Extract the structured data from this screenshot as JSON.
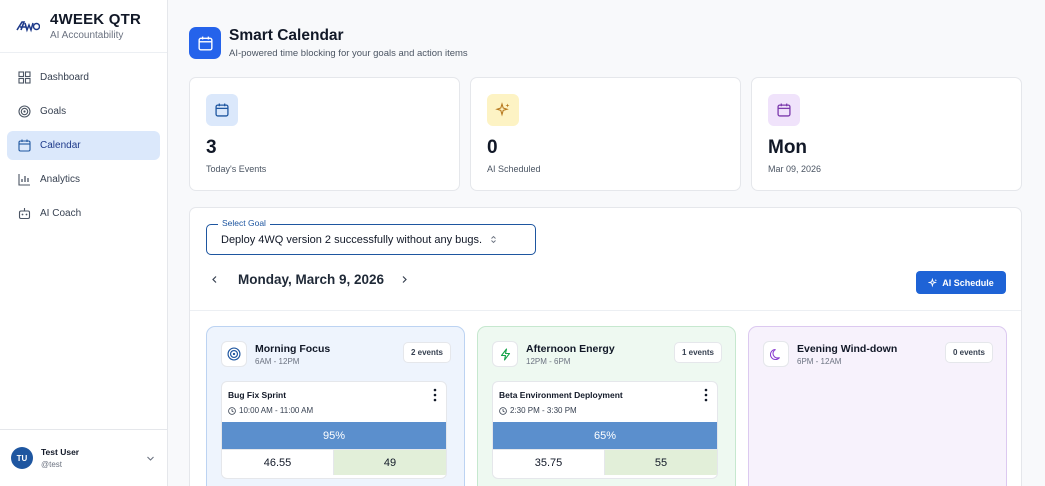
{
  "brand": {
    "title": "4WEEK QTR",
    "subtitle": "AI Accountability",
    "logo_text": "4WQ"
  },
  "nav": [
    {
      "label": "Dashboard",
      "icon": "grid-icon",
      "active": false
    },
    {
      "label": "Goals",
      "icon": "target-icon",
      "active": false
    },
    {
      "label": "Calendar",
      "icon": "calendar-icon",
      "active": true
    },
    {
      "label": "Analytics",
      "icon": "bar-chart-icon",
      "active": false
    },
    {
      "label": "AI Coach",
      "icon": "robot-icon",
      "active": false
    }
  ],
  "user": {
    "initials": "TU",
    "name": "Test User",
    "handle": "@test"
  },
  "header": {
    "title": "Smart Calendar",
    "subtitle": "AI-powered time blocking for your goals and action items"
  },
  "stats": [
    {
      "value": "3",
      "label": "Today's Events",
      "icon": "calendar-icon",
      "color": "#dbe8fb"
    },
    {
      "value": "0",
      "label": "AI Scheduled",
      "icon": "sparkles-icon",
      "color": "#fdf3c4"
    },
    {
      "value": "Mon",
      "label": "Mar 09, 2026",
      "icon": "calendar-icon",
      "color": "#f0e3fb"
    }
  ],
  "goal_select": {
    "legend": "Select Goal",
    "value": "Deploy 4WQ version 2 successfully without any bugs."
  },
  "date": {
    "label": "Monday, March 9, 2026"
  },
  "ai_button": {
    "label": "AI Schedule"
  },
  "slots": [
    {
      "name": "Morning Focus",
      "time": "6AM - 12PM",
      "badge": "2 events",
      "icon": "target-icon",
      "bg": "#eef4fd",
      "border": "#bcd3f2",
      "event": {
        "title": "Bug Fix Sprint",
        "time": "10:00 AM - 11:00 AM",
        "progress": "95%",
        "cell_a": "46.55",
        "cell_b": "49"
      }
    },
    {
      "name": "Afternoon Energy",
      "time": "12PM - 6PM",
      "badge": "1 events",
      "icon": "lightning-icon",
      "bg": "#eef9f1",
      "border": "#c6e8cf",
      "event": {
        "title": "Beta Environment Deployment",
        "time": "2:30 PM - 3:30 PM",
        "progress": "65%",
        "cell_a": "35.75",
        "cell_b": "55"
      }
    },
    {
      "name": "Evening Wind-down",
      "time": "6PM - 12AM",
      "badge": "0 events",
      "icon": "moon-icon",
      "bg": "#f7f2fc",
      "border": "#dcc9f0"
    }
  ]
}
